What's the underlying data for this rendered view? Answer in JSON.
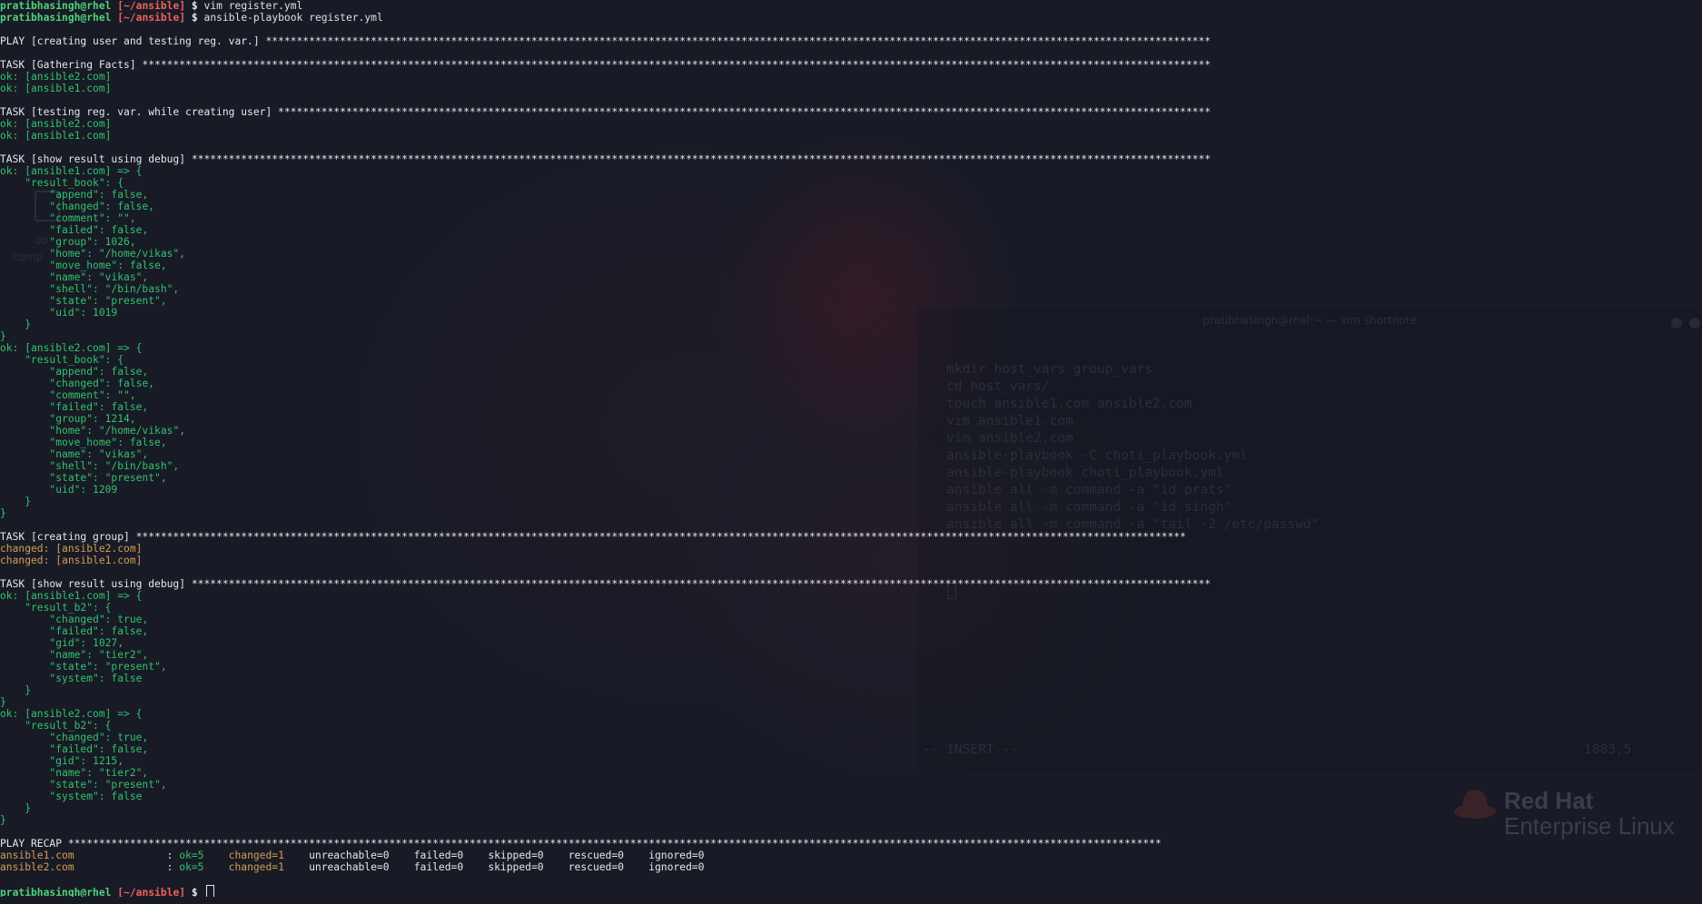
{
  "terminal": {
    "lines": [
      {
        "type": "prompt",
        "user": "pratibhasingh@rhel",
        "path": "[~/ansible]",
        "symbol": "$",
        "command": "vim register.yml"
      },
      {
        "type": "prompt",
        "user": "pratibhasingh@rhel",
        "path": "[~/ansible]",
        "symbol": "$",
        "command": "ansible-playbook register.yml"
      },
      {
        "type": "blank",
        "text": ""
      },
      {
        "type": "header",
        "text": "PLAY [creating user and testing reg. var.] *********************************************************************************************************************************************************"
      },
      {
        "type": "blank",
        "text": ""
      },
      {
        "type": "header",
        "text": "TASK [Gathering Facts] *****************************************************************************************************************************************************************************"
      },
      {
        "type": "ok",
        "text": "ok: [ansible2.com]"
      },
      {
        "type": "ok",
        "text": "ok: [ansible1.com]"
      },
      {
        "type": "blank",
        "text": ""
      },
      {
        "type": "header",
        "text": "TASK [testing reg. var. while creating user] *******************************************************************************************************************************************************"
      },
      {
        "type": "ok",
        "text": "ok: [ansible2.com]"
      },
      {
        "type": "ok",
        "text": "ok: [ansible1.com]"
      },
      {
        "type": "blank",
        "text": ""
      },
      {
        "type": "header",
        "text": "TASK [show result using debug] *********************************************************************************************************************************************************************"
      },
      {
        "type": "ok",
        "text": "ok: [ansible1.com] => {"
      },
      {
        "type": "ok",
        "text": "    \"result_book\": {"
      },
      {
        "type": "ok",
        "text": "        \"append\": false,"
      },
      {
        "type": "ok",
        "text": "        \"changed\": false,"
      },
      {
        "type": "ok",
        "text": "        \"comment\": \"\","
      },
      {
        "type": "ok",
        "text": "        \"failed\": false,"
      },
      {
        "type": "ok",
        "text": "        \"group\": 1026,"
      },
      {
        "type": "ok",
        "text": "        \"home\": \"/home/vikas\","
      },
      {
        "type": "ok",
        "text": "        \"move_home\": false,"
      },
      {
        "type": "ok",
        "text": "        \"name\": \"vikas\","
      },
      {
        "type": "ok",
        "text": "        \"shell\": \"/bin/bash\","
      },
      {
        "type": "ok",
        "text": "        \"state\": \"present\","
      },
      {
        "type": "ok",
        "text": "        \"uid\": 1019"
      },
      {
        "type": "ok",
        "text": "    }"
      },
      {
        "type": "ok",
        "text": "}"
      },
      {
        "type": "ok",
        "text": "ok: [ansible2.com] => {"
      },
      {
        "type": "ok",
        "text": "    \"result_book\": {"
      },
      {
        "type": "ok",
        "text": "        \"append\": false,"
      },
      {
        "type": "ok",
        "text": "        \"changed\": false,"
      },
      {
        "type": "ok",
        "text": "        \"comment\": \"\","
      },
      {
        "type": "ok",
        "text": "        \"failed\": false,"
      },
      {
        "type": "ok",
        "text": "        \"group\": 1214,"
      },
      {
        "type": "ok",
        "text": "        \"home\": \"/home/vikas\","
      },
      {
        "type": "ok",
        "text": "        \"move_home\": false,"
      },
      {
        "type": "ok",
        "text": "        \"name\": \"vikas\","
      },
      {
        "type": "ok",
        "text": "        \"shell\": \"/bin/bash\","
      },
      {
        "type": "ok",
        "text": "        \"state\": \"present\","
      },
      {
        "type": "ok",
        "text": "        \"uid\": 1209"
      },
      {
        "type": "ok",
        "text": "    }"
      },
      {
        "type": "ok",
        "text": "}"
      },
      {
        "type": "blank",
        "text": ""
      },
      {
        "type": "header",
        "text": "TASK [creating group] **************************************************************************************************************************************************************************"
      },
      {
        "type": "changed",
        "text": "changed: [ansible2.com]"
      },
      {
        "type": "changed",
        "text": "changed: [ansible1.com]"
      },
      {
        "type": "blank",
        "text": ""
      },
      {
        "type": "header",
        "text": "TASK [show result using debug] *********************************************************************************************************************************************************************"
      },
      {
        "type": "ok",
        "text": "ok: [ansible1.com] => {"
      },
      {
        "type": "ok",
        "text": "    \"result_b2\": {"
      },
      {
        "type": "ok",
        "text": "        \"changed\": true,"
      },
      {
        "type": "ok",
        "text": "        \"failed\": false,"
      },
      {
        "type": "ok",
        "text": "        \"gid\": 1027,"
      },
      {
        "type": "ok",
        "text": "        \"name\": \"tier2\","
      },
      {
        "type": "ok",
        "text": "        \"state\": \"present\","
      },
      {
        "type": "ok",
        "text": "        \"system\": false"
      },
      {
        "type": "ok",
        "text": "    }"
      },
      {
        "type": "ok",
        "text": "}"
      },
      {
        "type": "ok",
        "text": "ok: [ansible2.com] => {"
      },
      {
        "type": "ok",
        "text": "    \"result_b2\": {"
      },
      {
        "type": "ok",
        "text": "        \"changed\": true,"
      },
      {
        "type": "ok",
        "text": "        \"failed\": false,"
      },
      {
        "type": "ok",
        "text": "        \"gid\": 1215,"
      },
      {
        "type": "ok",
        "text": "        \"name\": \"tier2\","
      },
      {
        "type": "ok",
        "text": "        \"state\": \"present\","
      },
      {
        "type": "ok",
        "text": "        \"system\": false"
      },
      {
        "type": "ok",
        "text": "    }"
      },
      {
        "type": "ok",
        "text": "}"
      },
      {
        "type": "blank",
        "text": ""
      },
      {
        "type": "header",
        "text": "PLAY RECAP *********************************************************************************************************************************************************************************"
      },
      {
        "type": "recap",
        "host": "ansible1.com               ",
        "sep": ": ",
        "ok": "ok=5   ",
        "changed": " changed=1 ",
        "rest": "   unreachable=0    failed=0    skipped=0    rescued=0    ignored=0"
      },
      {
        "type": "recap",
        "host": "ansible2.com               ",
        "sep": ": ",
        "ok": "ok=5   ",
        "changed": " changed=1 ",
        "rest": "   unreachable=0    failed=0    skipped=0    rescued=0    ignored=0"
      },
      {
        "type": "blank",
        "text": ""
      },
      {
        "type": "prompt",
        "user": "pratibhasingh@rhel",
        "path": "[~/ansible]",
        "symbol": "$",
        "command": "",
        "cursor": true
      }
    ]
  },
  "background": {
    "window_title": "pratibhasingh@rhel:~ — vim shortnote",
    "vim_lines": [
      "mkdir host_vars group_vars",
      "cd host_vars/",
      "touch ansible1.com ansible2.com",
      "vim ansible1.com",
      "vim ansible2.com",
      "ansible-playbook -C choti_playbook.yml",
      "ansible-playbook choti_playbook.yml",
      "ansible all -m command -a \"id prats\"",
      "ansible all -m command -a \"id singh\"",
      "ansible all -m command -a \"tail -2 /etc/passwd\""
    ],
    "vim_mode": "-- INSERT --",
    "vim_position": "1883,5",
    "desktop_label_1": "do",
    "desktop_label_2": "comp",
    "logo_line1": "Red Hat",
    "logo_line2": "Enterprise Linux"
  },
  "colors": {
    "prompt_user": "#4fd17a",
    "prompt_path": "#f0605c",
    "ok": "#31c26b",
    "changed": "#d39e51",
    "text": "#e8e8e8",
    "background": "#181b26"
  }
}
